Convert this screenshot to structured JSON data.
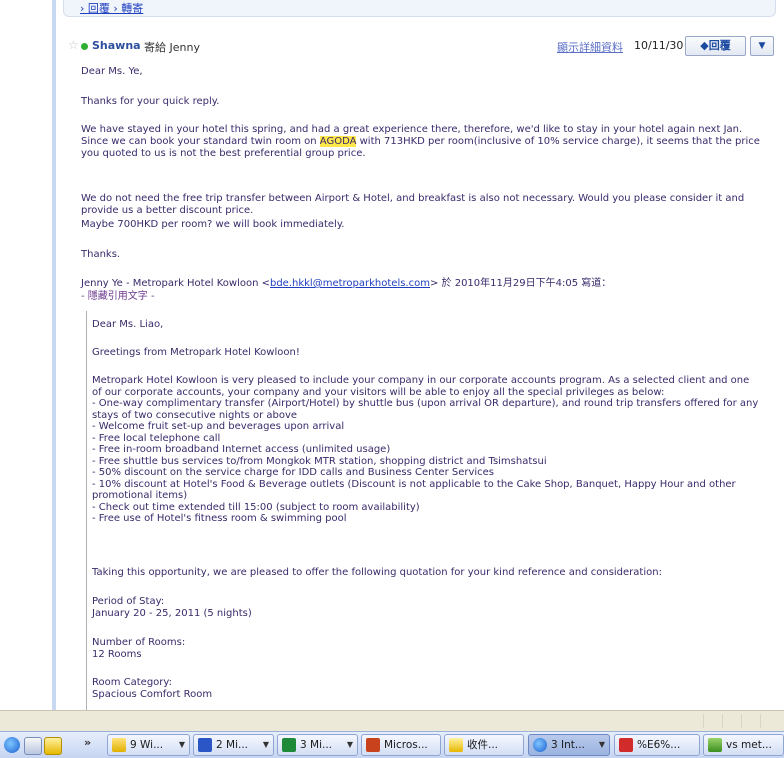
{
  "prev_message": {
    "links": "› 回覆 › 轉寄"
  },
  "header": {
    "sender": "Shawna",
    "sent_to": "寄給 Jenny",
    "details_link": "顯示詳細資料",
    "date": "10/11/30",
    "reply_label": "◆回覆",
    "more_label": "▼"
  },
  "body": {
    "greeting": "Dear Ms. Ye,",
    "thanks_quick": "Thanks for your quick reply.",
    "p1_a": "We have stayed in your hotel this spring, and had a great experience there, therefore, we'd like to stay in your hotel again next Jan. Since we can book your standard twin room on ",
    "p1_highlight": "AGODA",
    "p1_b": " with 713HKD per room(inclusive of 10% service charge), it seems that the price you quoted to us is not the best preferential group price.",
    "p2": "We do not need the free trip transfer between Airport & Hotel, and breakfast is also not necessary. Would you please consider it and provide us a better discount price.",
    "p3": "Maybe 700HKD per room? we will book immediately.",
    "thanks": "Thanks.",
    "quote_prefix": "Jenny Ye - Metropark Hotel Kowloon <",
    "quote_email": "bde.hkkl@metroparkhotels.com",
    "quote_suffix": "> 於 2010年11月29日下午4:05 寫道：",
    "hide_quote": "- 隱藏引用文字 -"
  },
  "quoted": {
    "greeting": "Dear Ms. Liao,",
    "greetings_line": "Greetings from Metropark Hotel Kowloon!",
    "intro": "Metropark Hotel Kowloon is very pleased to include your company in our corporate accounts program. As a selected client and one of our corporate accounts, your company and your visitors will be able to enjoy all the special privileges as below:",
    "privileges": [
      "-    One-way complimentary transfer (Airport/Hotel) by shuttle bus (upon arrival OR departure), and round trip transfers offered for any stays of two consecutive nights or above",
      "-    Welcome fruit set-up and beverages upon arrival",
      "-    Free local telephone call",
      "-    Free in-room broadband Internet access (unlimited usage)",
      "-    Free shuttle bus services to/from Mongkok MTR station, shopping district and Tsimshatsui",
      "-    50% discount on the service charge for IDD calls and Business Center Services",
      "-    10% discount at Hotel's Food & Beverage outlets (Discount is not applicable to the Cake Shop, Banquet, Happy Hour and other promotional items)",
      "-    Check out time extended till 15:00 (subject to room availability)",
      "-    Free use of Hotel's fitness room & swimming pool"
    ],
    "opportunity": "Taking this opportunity, we are pleased to offer the following quotation for your kind reference and consideration:",
    "period_label": "Period of Stay:",
    "period_value": "January 20 - 25, 2011 (5 nights)",
    "rooms_label": "Number of Rooms:",
    "rooms_value": "12 Rooms",
    "category_label": "Room Category:",
    "category_value": "Spacious Comfort Room"
  },
  "taskbar": {
    "chevron": "»",
    "buttons": [
      {
        "label": "9 Wi...",
        "arrow": "▼"
      },
      {
        "label": "2 Mi...",
        "arrow": "▼"
      },
      {
        "label": "3 Mi...",
        "arrow": "▼"
      },
      {
        "label": "Micros...",
        "arrow": ""
      },
      {
        "label": "收件...",
        "arrow": ""
      },
      {
        "label": "3 Int...",
        "arrow": "▼"
      },
      {
        "label": "%E6%...",
        "arrow": ""
      },
      {
        "label": "vs met...",
        "arrow": ""
      }
    ]
  },
  "colors": {
    "sender": "#2b4f9d",
    "body_text": "#3a2a6a",
    "highlight": "#ffe84a",
    "link": "#1f3fbf"
  }
}
